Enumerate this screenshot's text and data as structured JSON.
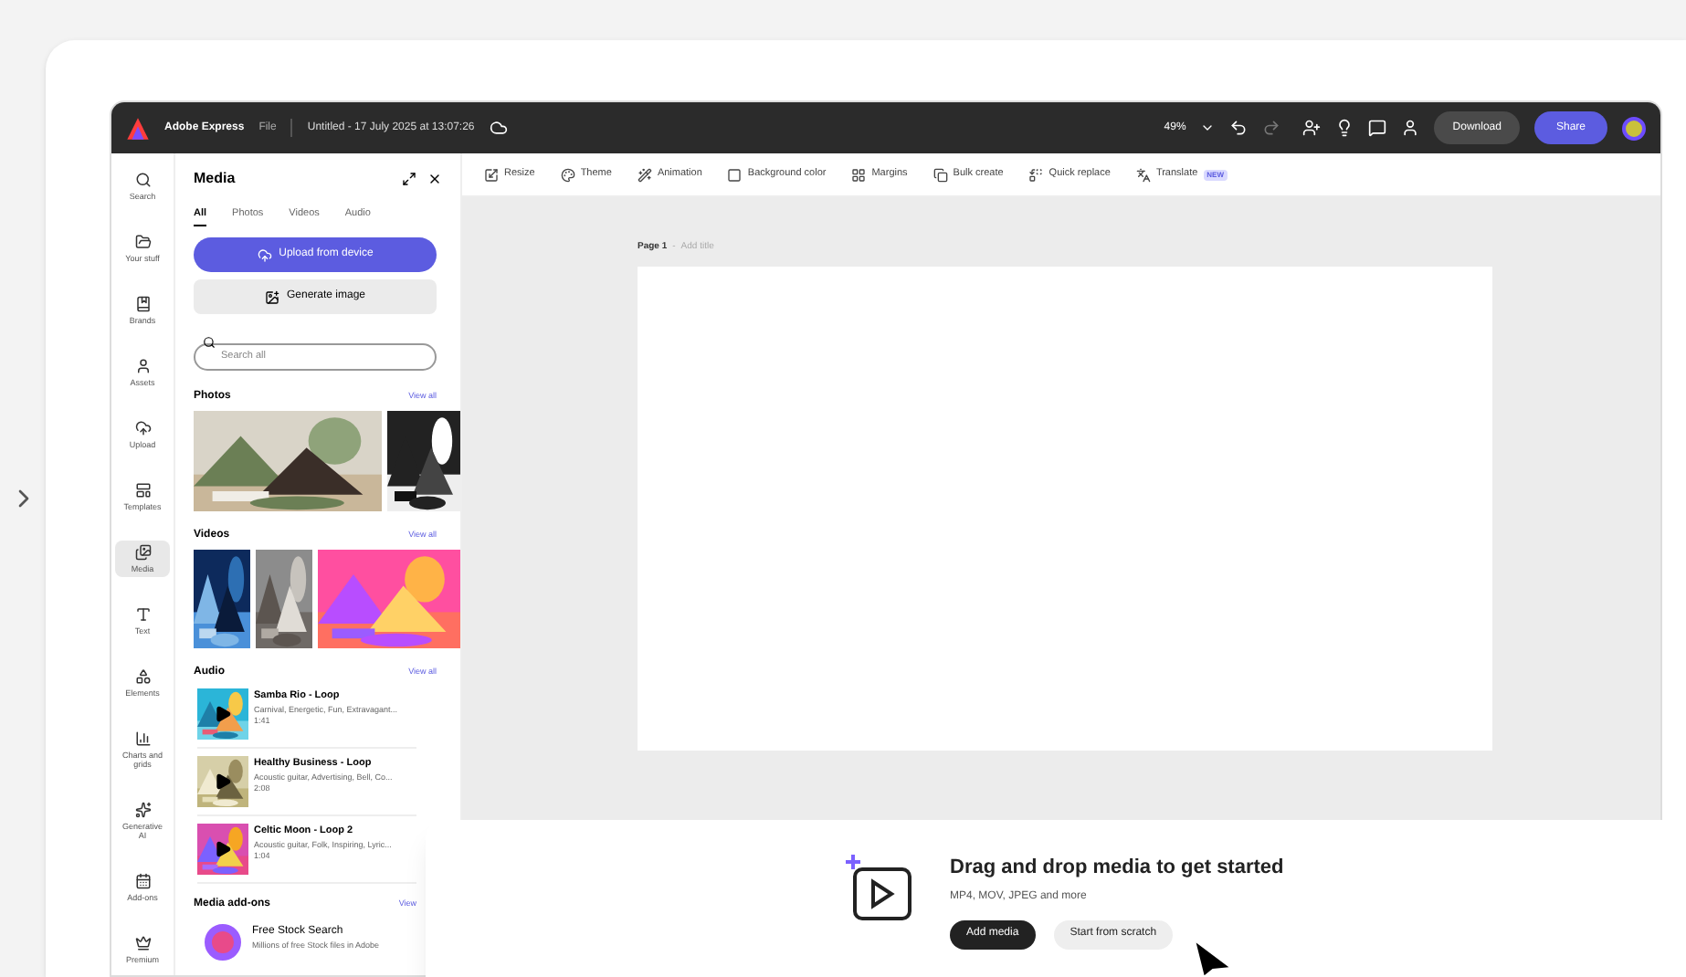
{
  "app_bar": {
    "app_name": "Adobe Express",
    "menu": "File",
    "document_title": "Untitled - 17 July 2025 at 13:07:26",
    "zoom": "49%",
    "download": "Download",
    "share": "Share"
  },
  "rail": [
    {
      "label": "Search",
      "selected": false
    },
    {
      "label": "Your stuff",
      "selected": false
    },
    {
      "label": "Brands",
      "selected": false
    },
    {
      "label": "Assets",
      "selected": false
    },
    {
      "label": "Upload",
      "selected": false
    },
    {
      "label": "Templates",
      "selected": false
    },
    {
      "label": "Media",
      "selected": true
    },
    {
      "label": "Text",
      "selected": false
    },
    {
      "label": "Elements",
      "selected": false
    },
    {
      "label": "Charts and grids",
      "selected": false
    },
    {
      "label": "Generative AI",
      "selected": false
    },
    {
      "label": "Add-ons",
      "selected": false
    },
    {
      "label": "Premium",
      "selected": false
    }
  ],
  "media_panel": {
    "title": "Media",
    "tabs": [
      {
        "label": "All",
        "selected": true
      },
      {
        "label": "Photos",
        "selected": false
      },
      {
        "label": "Videos",
        "selected": false
      },
      {
        "label": "Audio",
        "selected": false
      }
    ],
    "upload_button": "Upload from device",
    "generate_button": "Generate image",
    "search": {
      "placeholder": "Search all"
    },
    "photos": {
      "title": "Photos",
      "link": "View all"
    },
    "videos": {
      "title": "Videos",
      "link": "View all"
    },
    "audio": {
      "title": "Audio",
      "link": "View all",
      "tracks": [
        {
          "title": "Samba Rio - Loop",
          "description": "Carnival, Energetic, Fun, Extravagant...",
          "duration": "1:41"
        },
        {
          "title": "Healthy Business - Loop",
          "description": "Acoustic guitar, Advertising, Bell, Co...",
          "duration": "2:08"
        },
        {
          "title": "Celtic Moon - Loop 2",
          "description": "Acoustic guitar, Folk, Inspiring, Lyric...",
          "duration": "1:04"
        }
      ]
    },
    "addons": {
      "title": "Media add-ons",
      "link": "View",
      "items": [
        {
          "title": "Free Stock Search",
          "description": "Millions of free Stock files in Adobe"
        }
      ]
    }
  },
  "toolbar": [
    {
      "label": "Resize"
    },
    {
      "label": "Theme"
    },
    {
      "label": "Animation"
    },
    {
      "label": "Background color"
    },
    {
      "label": "Margins"
    },
    {
      "label": "Bulk create"
    },
    {
      "label": "Quick replace"
    },
    {
      "label": "Translate",
      "badge": "NEW"
    }
  ],
  "canvas": {
    "page_label": "Page 1",
    "separator": "-",
    "title_placeholder": "Add title"
  },
  "drop_prompt": {
    "heading": "Drag and drop media to get started",
    "formats": "MP4, MOV, JPEG and more",
    "primary_button": "Add media",
    "secondary_button": "Start from scratch"
  }
}
